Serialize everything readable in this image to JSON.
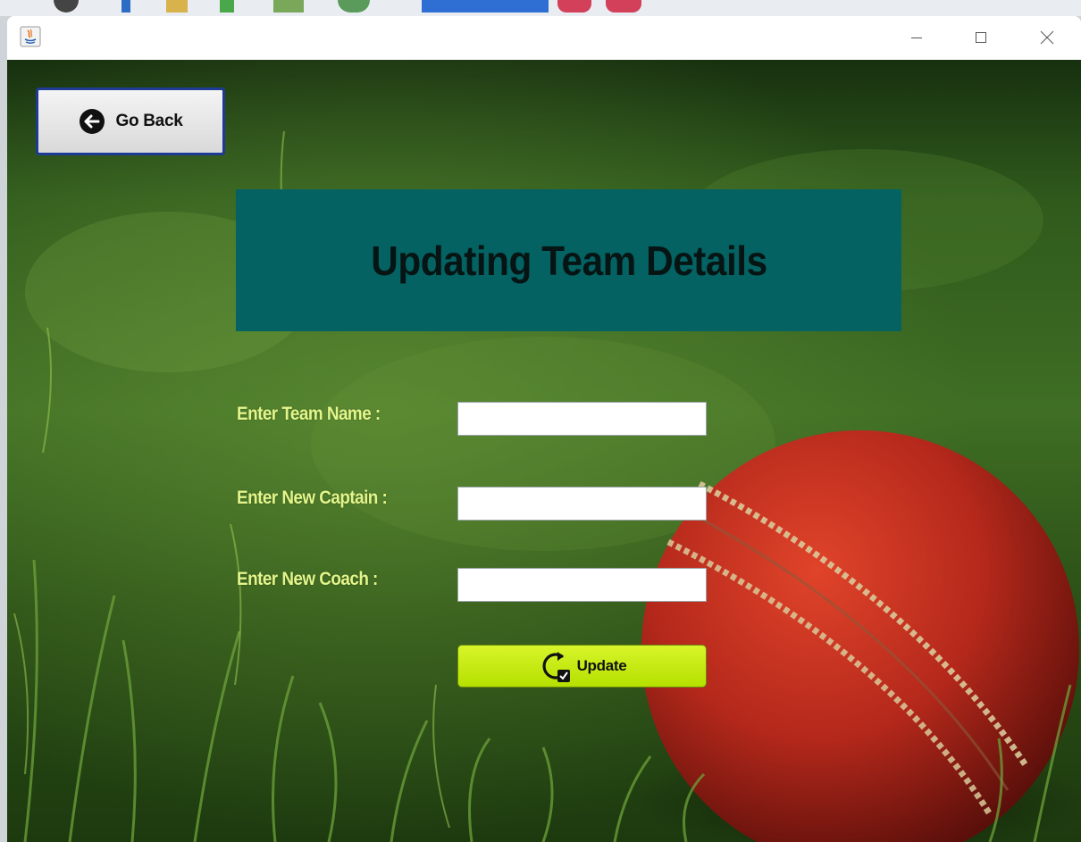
{
  "window": {
    "minimize_icon": "minimize-icon",
    "maximize_icon": "maximize-icon",
    "close_icon": "close-icon",
    "app_icon": "java-app-icon"
  },
  "nav": {
    "back_label": "Go Back",
    "back_icon": "arrow-left-circle-icon"
  },
  "header": {
    "title": "Updating Team Details",
    "background": "#046262"
  },
  "form": {
    "team_name_label": "Enter Team Name :",
    "team_name_value": "",
    "captain_label": "Enter New Captain :",
    "captain_value": "",
    "coach_label": "Enter New Coach :",
    "coach_value": "",
    "label_color": "#e3f58a"
  },
  "actions": {
    "update_label": "Update",
    "update_icon": "refresh-check-icon",
    "update_color": "#c8ef10"
  }
}
